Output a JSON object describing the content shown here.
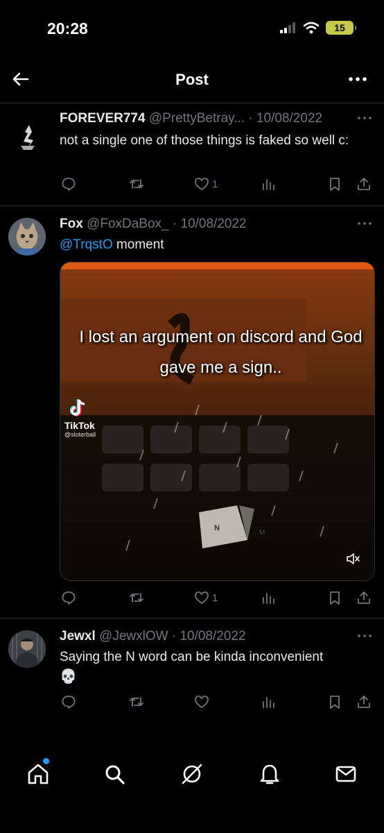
{
  "status_bar": {
    "time": "20:28",
    "battery": "15"
  },
  "header": {
    "title": "Post"
  },
  "tweets": [
    {
      "name": "FOREVER774",
      "handle": "@PrettyBetray...",
      "date": "· 10/08/2022",
      "text": "not a single one of those things is faked so well c:",
      "likes": "1"
    },
    {
      "name": "Fox",
      "handle": "@FoxDaBox_",
      "date": "· 10/08/2022",
      "mention": "@TrqstO",
      "text": " moment",
      "likes": "1",
      "media": {
        "caption": "I lost an argument on discord and God gave me a sign..",
        "watermark_brand": "TikTok",
        "watermark_handle": "@sloterball",
        "key_letter": "N",
        "key_letter_2": "M"
      }
    },
    {
      "name": "Jewxl",
      "handle": "@JewxlOW",
      "date": "· 10/08/2022",
      "text": "Saying the N word can be kinda inconvenient",
      "emoji": "💀"
    }
  ],
  "colors": {
    "accent": "#1d9bf0",
    "muted": "#71767b",
    "text": "#e7e9ea",
    "background": "#000000"
  },
  "icons": {
    "status": [
      "signal-icon",
      "wifi-icon",
      "battery-icon"
    ],
    "actions": [
      "reply-icon",
      "repost-icon",
      "like-icon",
      "views-icon",
      "bookmark-icon",
      "share-icon"
    ],
    "nav": [
      "home-icon",
      "search-icon",
      "grok-icon",
      "notifications-icon",
      "messages-icon"
    ]
  }
}
